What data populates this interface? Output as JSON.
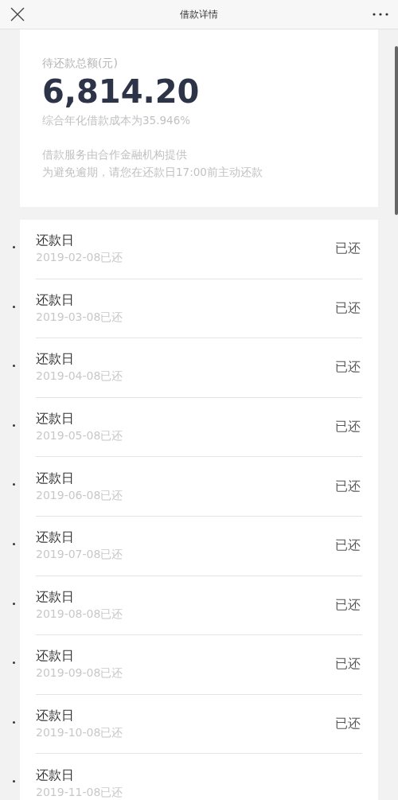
{
  "header": {
    "title": "借款详情"
  },
  "summary": {
    "label": "待还款总额(元)",
    "amount": "6,814.20",
    "rate": "综合年化借款成本为35.946%",
    "notes": [
      "借款服务由合作金融机构提供",
      "为避免逾期，请您在还款日17:00前主动还款"
    ]
  },
  "installments": [
    {
      "title": "还款日",
      "date": "2019-02-08已还",
      "status": "已还"
    },
    {
      "title": "还款日",
      "date": "2019-03-08已还",
      "status": "已还"
    },
    {
      "title": "还款日",
      "date": "2019-04-08已还",
      "status": "已还"
    },
    {
      "title": "还款日",
      "date": "2019-05-08已还",
      "status": "已还"
    },
    {
      "title": "还款日",
      "date": "2019-06-08已还",
      "status": "已还"
    },
    {
      "title": "还款日",
      "date": "2019-07-08已还",
      "status": "已还"
    },
    {
      "title": "还款日",
      "date": "2019-08-08已还",
      "status": "已还"
    },
    {
      "title": "还款日",
      "date": "2019-09-08已还",
      "status": "已还"
    },
    {
      "title": "还款日",
      "date": "2019-10-08已还",
      "status": "已还"
    },
    {
      "title": "还款日",
      "date": "2019-11-08已还"
    }
  ]
}
